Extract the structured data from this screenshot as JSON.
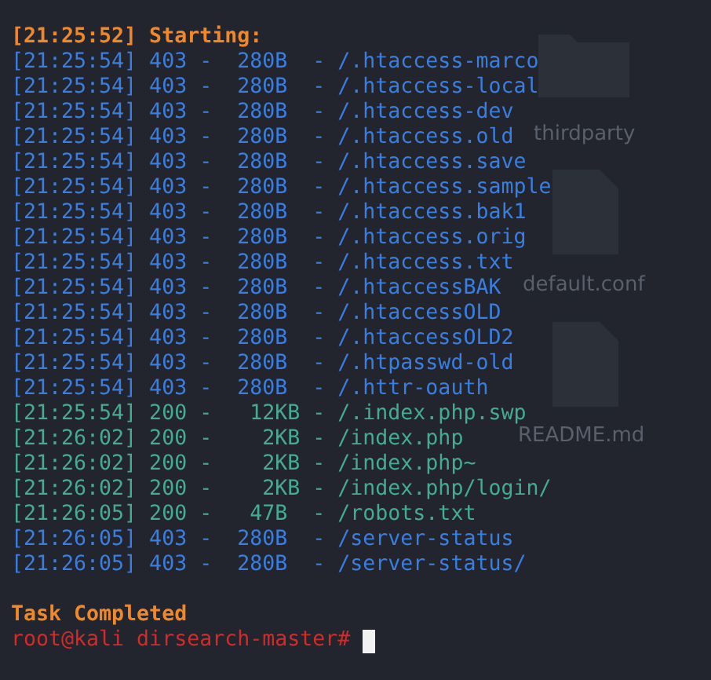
{
  "desktop": {
    "items": [
      {
        "kind": "folder",
        "label": "thirdparty"
      },
      {
        "kind": "file",
        "label": "default.conf"
      },
      {
        "kind": "file",
        "label": "README.md"
      }
    ]
  },
  "terminal": {
    "lines": [
      {
        "kind": "start",
        "text": "[21:25:52] Starting:"
      },
      {
        "kind": "forbidden",
        "text": "[21:25:54] 403 -  280B  - /.htaccess-marco"
      },
      {
        "kind": "forbidden",
        "text": "[21:25:54] 403 -  280B  - /.htaccess-local"
      },
      {
        "kind": "forbidden",
        "text": "[21:25:54] 403 -  280B  - /.htaccess-dev"
      },
      {
        "kind": "forbidden",
        "text": "[21:25:54] 403 -  280B  - /.htaccess.old"
      },
      {
        "kind": "forbidden",
        "text": "[21:25:54] 403 -  280B  - /.htaccess.save"
      },
      {
        "kind": "forbidden",
        "text": "[21:25:54] 403 -  280B  - /.htaccess.sample"
      },
      {
        "kind": "forbidden",
        "text": "[21:25:54] 403 -  280B  - /.htaccess.bak1"
      },
      {
        "kind": "forbidden",
        "text": "[21:25:54] 403 -  280B  - /.htaccess.orig"
      },
      {
        "kind": "forbidden",
        "text": "[21:25:54] 403 -  280B  - /.htaccess.txt"
      },
      {
        "kind": "forbidden",
        "text": "[21:25:54] 403 -  280B  - /.htaccessBAK"
      },
      {
        "kind": "forbidden",
        "text": "[21:25:54] 403 -  280B  - /.htaccessOLD"
      },
      {
        "kind": "forbidden",
        "text": "[21:25:54] 403 -  280B  - /.htaccessOLD2"
      },
      {
        "kind": "forbidden",
        "text": "[21:25:54] 403 -  280B  - /.htpasswd-old"
      },
      {
        "kind": "forbidden",
        "text": "[21:25:54] 403 -  280B  - /.httr-oauth"
      },
      {
        "kind": "ok",
        "text": "[21:25:54] 200 -   12KB - /.index.php.swp"
      },
      {
        "kind": "ok",
        "text": "[21:26:02] 200 -    2KB - /index.php"
      },
      {
        "kind": "ok",
        "text": "[21:26:02] 200 -    2KB - /index.php~"
      },
      {
        "kind": "ok",
        "text": "[21:26:02] 200 -    2KB - /index.php/login/"
      },
      {
        "kind": "ok",
        "text": "[21:26:05] 200 -   47B  - /robots.txt"
      },
      {
        "kind": "forbidden",
        "text": "[21:26:05] 403 -  280B  - /server-status"
      },
      {
        "kind": "forbidden",
        "text": "[21:26:05] 403 -  280B  - /server-status/"
      },
      {
        "kind": "done",
        "text": "Task Completed"
      }
    ],
    "prompt": {
      "text": "root@kali dirsearch-master#"
    }
  }
}
